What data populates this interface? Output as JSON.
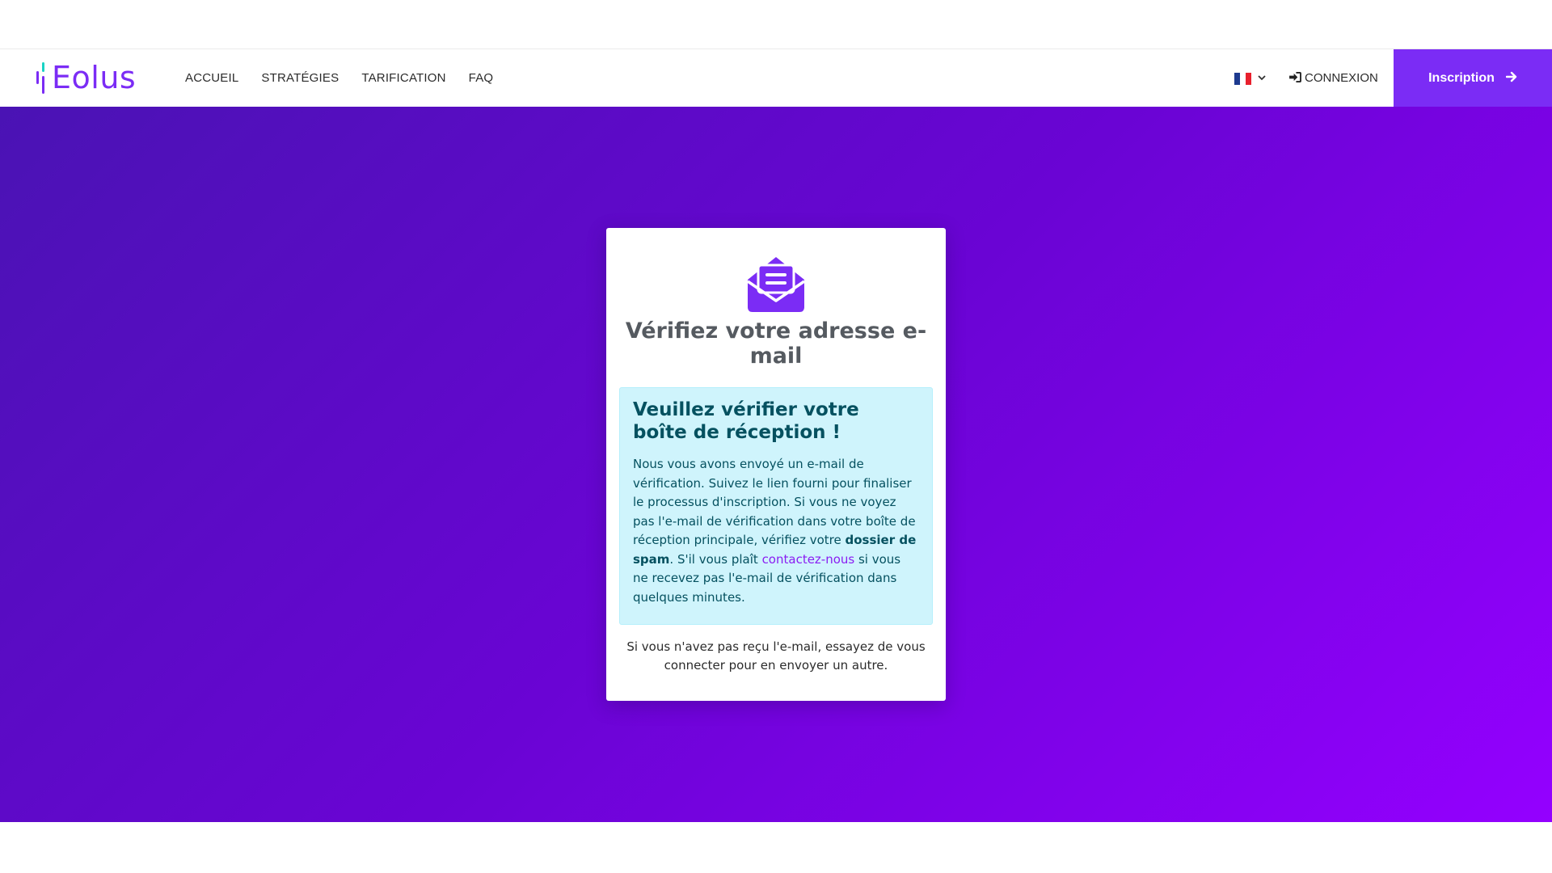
{
  "header": {
    "logo_text": "Eolus",
    "nav": [
      {
        "label": "ACCUEIL"
      },
      {
        "label": "STRATÉGIES"
      },
      {
        "label": "TARIFICATION"
      },
      {
        "label": "FAQ"
      }
    ],
    "language": {
      "icon": "flag-france-icon",
      "chevron_icon": "chevron-down-icon"
    },
    "login": {
      "label": "CONNEXION",
      "icon": "sign-in-icon"
    },
    "signup": {
      "label": "Inscription",
      "icon": "arrow-right-icon"
    }
  },
  "colors": {
    "brand": "#7b2cf5",
    "accent_teal": "#19d3c5",
    "gradient_start": "#4a13b4",
    "gradient_end": "#9400ff",
    "alert_bg": "#cff4fc",
    "alert_text": "#055160",
    "link": "#8a1df2"
  },
  "card": {
    "icon": "envelope-open-text-icon",
    "title": "Vérifiez votre adresse e-mail",
    "alert": {
      "heading": "Veuillez vérifier votre boîte de réception !",
      "text_before_bold": "Nous vous avons envoyé un e-mail de vérification. Suivez le lien fourni pour finaliser le processus d'inscription. Si vous ne voyez pas l'e-mail de vérification dans votre boîte de réception principale, vérifiez votre ",
      "bold_text": "dossier de spam",
      "text_after_bold": ". S'il vous plaît ",
      "link_text": "contactez-nous",
      "text_end": " si vous ne recevez pas l'e-mail de vérification dans quelques minutes."
    },
    "footnote": "Si vous n'avez pas reçu l'e-mail, essayez de vous connecter pour en envoyer un autre."
  }
}
